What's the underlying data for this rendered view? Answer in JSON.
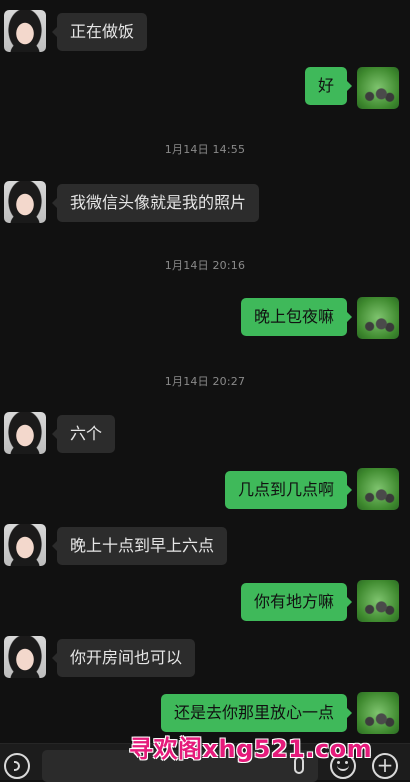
{
  "chat": {
    "items": [
      {
        "type": "message",
        "from": "contact",
        "text": "正在做饭"
      },
      {
        "type": "message",
        "from": "me",
        "text": "好"
      },
      {
        "type": "timestamp",
        "text": "1月14日 14:55"
      },
      {
        "type": "message",
        "from": "contact",
        "text": "我微信头像就是我的照片"
      },
      {
        "type": "timestamp",
        "text": "1月14日 20:16"
      },
      {
        "type": "message",
        "from": "me",
        "text": "晚上包夜嘛"
      },
      {
        "type": "timestamp",
        "text": "1月14日 20:27"
      },
      {
        "type": "message",
        "from": "contact",
        "text": "六个"
      },
      {
        "type": "message",
        "from": "me",
        "text": "几点到几点啊"
      },
      {
        "type": "message",
        "from": "contact",
        "text": "晚上十点到早上六点"
      },
      {
        "type": "message",
        "from": "me",
        "text": "你有地方嘛"
      },
      {
        "type": "message",
        "from": "contact",
        "text": "你开房间也可以"
      },
      {
        "type": "message",
        "from": "me",
        "text": "还是去你那里放心一点"
      }
    ]
  },
  "input_bar": {
    "voice_icon": "voice-icon",
    "mic_icon": "microphone-icon",
    "emoji_icon": "emoji-icon",
    "plus_icon": "plus-icon",
    "plus_glyph": "+",
    "input_value": ""
  },
  "watermark": "寻欢阁xhg521.com",
  "colors": {
    "background": "#111111",
    "incoming_bubble": "#2c2c2c",
    "outgoing_bubble": "#3fb95a",
    "watermark": "#e51b7b"
  }
}
